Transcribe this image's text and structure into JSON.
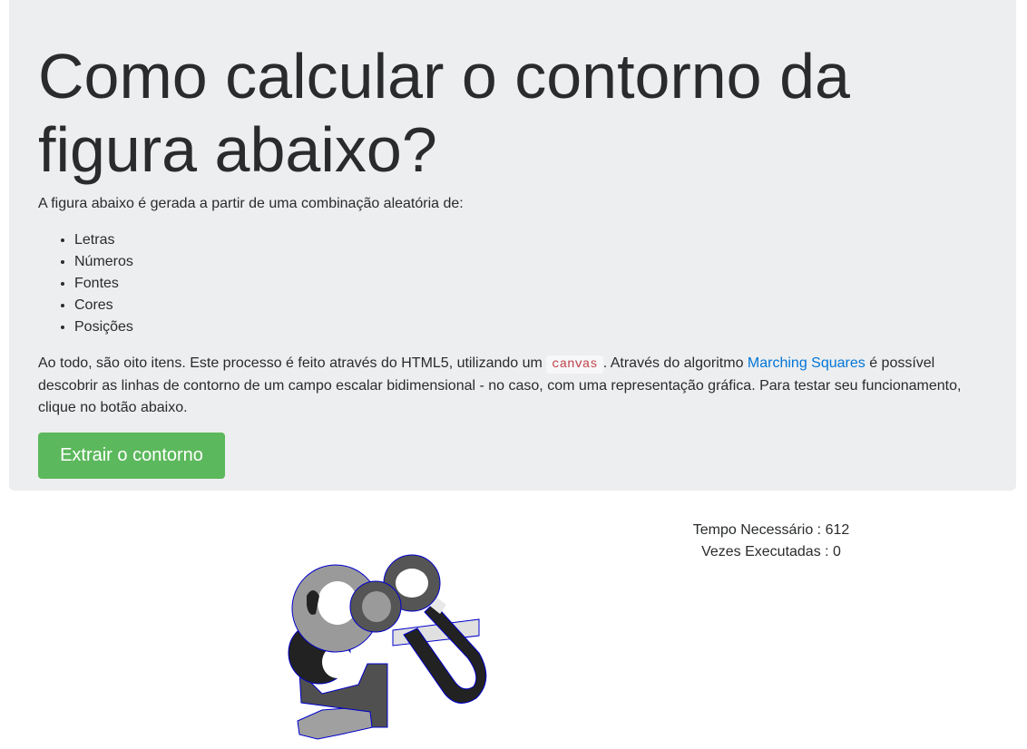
{
  "header": {
    "title": "Como calcular o contorno da figura abaixo?",
    "intro": "A figura abaixo é gerada a partir de uma combinação aleatória de:",
    "items": [
      "Letras",
      "Números",
      "Fontes",
      "Cores",
      "Posições"
    ],
    "desc_part1": "Ao todo, são oito itens. Este processo é feito através do HTML5, utilizando um ",
    "desc_code": "canvas",
    "desc_part2": ". Através do algoritmo ",
    "desc_link": "Marching Squares",
    "desc_part3": " é possível descobrir as linhas de contorno de um campo escalar bidimensional - no caso, com uma representação gráfica. Para testar seu funcionamento, clique no botão abaixo.",
    "button_label": "Extrair o contorno"
  },
  "stats": {
    "time": "Tempo Necessário : 612",
    "runs": "Vezes Executadas : 0"
  },
  "colors": {
    "jumbotron_bg": "#eceeef",
    "button_green": "#5cb85c",
    "link_blue": "#0275d8",
    "code_red": "#bd4147",
    "contour_blue": "#0000cc"
  }
}
